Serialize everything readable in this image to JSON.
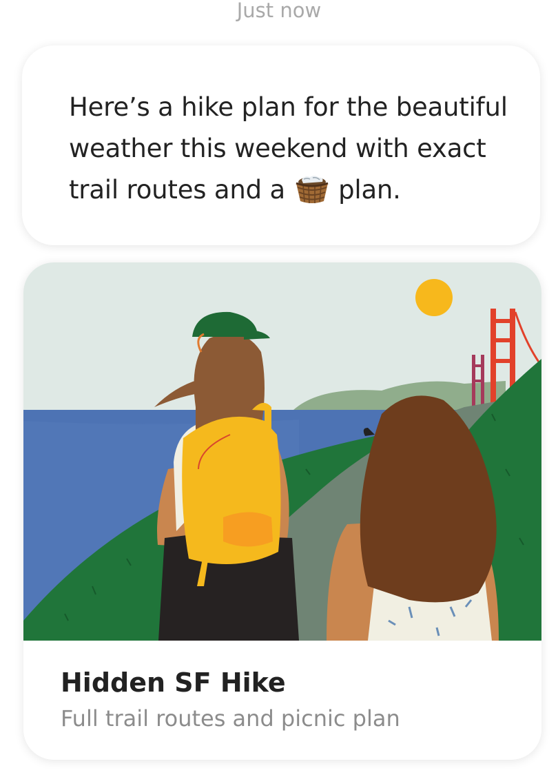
{
  "message": {
    "timestamp": "Just now",
    "text_before_emoji": "Here’s a hike plan for the beautiful weather this weekend with exact trail routes and a",
    "emoji": "basket-icon",
    "text_after_emoji": "plan."
  },
  "card": {
    "title": "Hidden SF Hike",
    "subtitle": "Full trail routes and picnic plan",
    "illustration": "two-hikers-golden-gate-bridge"
  },
  "colors": {
    "sky": "#dfe9e5",
    "ocean": "#4d73b4",
    "hills": "#20753a",
    "sun": "#f7b81c",
    "bridge": "#e2412a",
    "backpack": "#f5b91d",
    "title_text": "#222222",
    "subtitle_text": "#8c8c8c"
  }
}
